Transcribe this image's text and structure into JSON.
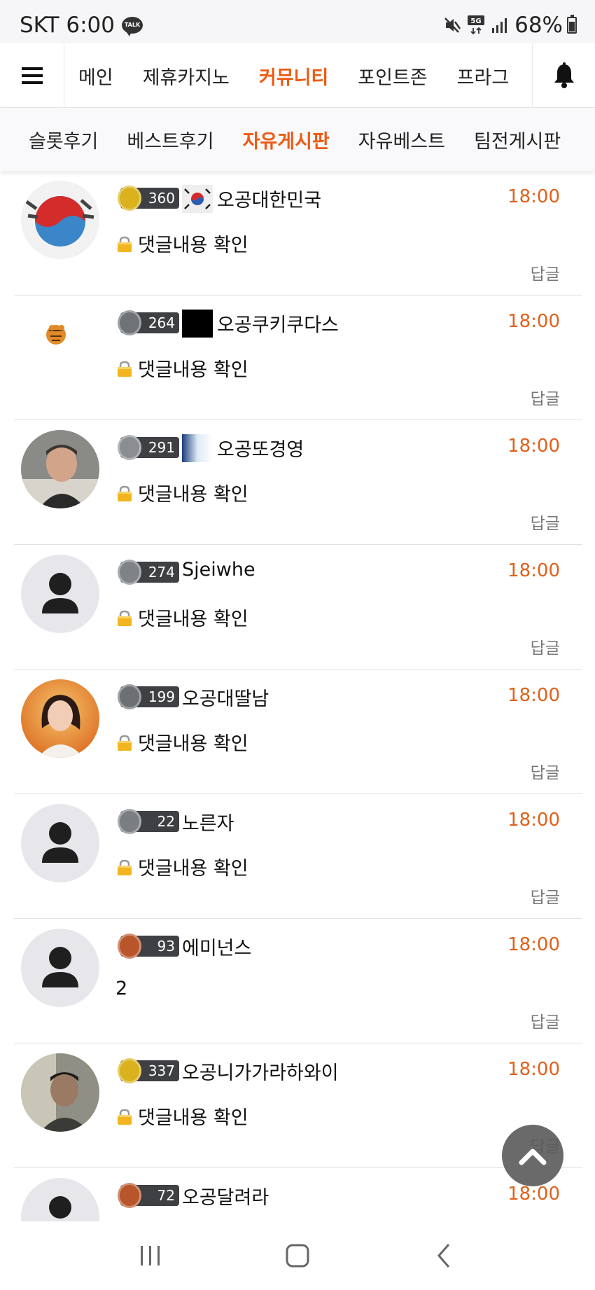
{
  "status_bar": {
    "carrier_time": "SKT 6:00",
    "talk_badge": "TALK",
    "battery_percent": "68%",
    "battery_level": 0.68,
    "icons": [
      "talk-icon",
      "mute-icon",
      "5g-icon",
      "signal-icon",
      "battery-icon"
    ]
  },
  "main_nav": {
    "items": [
      {
        "label": "메인",
        "active": false
      },
      {
        "label": "제휴카지노",
        "active": false
      },
      {
        "label": "커뮤니티",
        "active": true
      },
      {
        "label": "포인트존",
        "active": false
      },
      {
        "label": "프라그",
        "active": false
      }
    ],
    "menu_icon": "hamburger-icon",
    "bell_icon": "bell-icon"
  },
  "sub_nav": {
    "items": [
      {
        "label": "슬롯후기",
        "active": false
      },
      {
        "label": "베스트후기",
        "active": false
      },
      {
        "label": "자유게시판",
        "active": true
      },
      {
        "label": "자유베스트",
        "active": false
      },
      {
        "label": "팀전게시판",
        "active": false
      }
    ]
  },
  "comments": [
    {
      "level": "360",
      "nickname": "오공대한민국",
      "time": "18:00",
      "content": "댓글내용 확인",
      "locked": true,
      "reply": "답글"
    },
    {
      "level": "264",
      "nickname": "오공쿠키쿠다스",
      "time": "18:00",
      "content": "댓글내용 확인",
      "locked": true,
      "reply": "답글"
    },
    {
      "level": "291",
      "nickname": "오공또경영",
      "time": "18:00",
      "content": "댓글내용 확인",
      "locked": true,
      "reply": "답글"
    },
    {
      "level": "274",
      "nickname": "Sjeiwhe",
      "time": "18:00",
      "content": "댓글내용 확인",
      "locked": true,
      "reply": "답글"
    },
    {
      "level": "199",
      "nickname": "오공대딸남",
      "time": "18:00",
      "content": "댓글내용 확인",
      "locked": true,
      "reply": "답글"
    },
    {
      "level": "22",
      "nickname": "노른자",
      "time": "18:00",
      "content": "댓글내용 확인",
      "locked": true,
      "reply": "답글"
    },
    {
      "level": "93",
      "nickname": "에미넌스",
      "time": "18:00",
      "content": "2",
      "locked": false,
      "reply": "답글"
    },
    {
      "level": "337",
      "nickname": "오공니가가라하와이",
      "time": "18:00",
      "content": "댓글내용 확인",
      "locked": true,
      "reply": "답글"
    },
    {
      "level": "72",
      "nickname": "오공달려라",
      "time": "18:00",
      "content": "",
      "locked": false,
      "reply": ""
    }
  ],
  "colors": {
    "accent": "#ee5a13",
    "time": "#e0601a",
    "lock": "#f2b51f"
  },
  "scroll_top_icon": "chevron-up-icon",
  "system_nav": {
    "icons": [
      "recent-apps-icon",
      "home-icon",
      "back-icon"
    ]
  }
}
